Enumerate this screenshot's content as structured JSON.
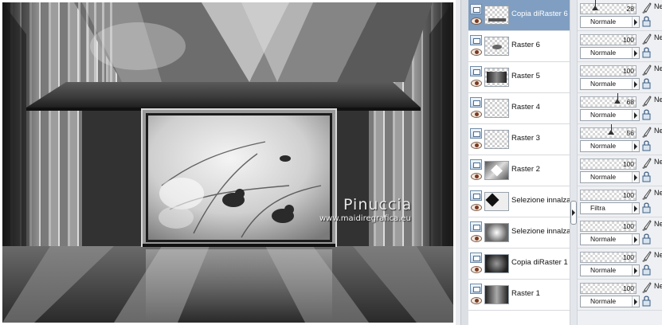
{
  "canvas": {
    "watermark_title": "Pinuccia",
    "watermark_url": "www.maidiregrafica.eu"
  },
  "layers": [
    {
      "name": "Copia diRaster 6",
      "selected": true,
      "thumb": "bar-icon"
    },
    {
      "name": "Raster 6",
      "selected": false,
      "thumb": "bird-icon"
    },
    {
      "name": "Raster 5",
      "selected": false,
      "thumb": "dark-frame-icon"
    },
    {
      "name": "Raster 4",
      "selected": false,
      "thumb": "transparent"
    },
    {
      "name": "Raster 3",
      "selected": false,
      "thumb": "transparent"
    },
    {
      "name": "Raster 2",
      "selected": false,
      "thumb": "pattern-icon"
    },
    {
      "name": "Selezione innalzat",
      "selected": false,
      "thumb": "chevron-pattern-icon"
    },
    {
      "name": "Selezione innalzat",
      "selected": false,
      "thumb": "star-pattern-icon"
    },
    {
      "name": "Copia diRaster 1",
      "selected": false,
      "thumb": "dark-pattern-icon"
    },
    {
      "name": "Raster 1",
      "selected": false,
      "thumb": "gradient-icon"
    }
  ],
  "properties": [
    {
      "opacity": 28,
      "opacity_text": "28",
      "blend": "Normale",
      "truncated": "Ne"
    },
    {
      "opacity": 100,
      "opacity_text": "100",
      "blend": "Normale",
      "truncated": "Ne"
    },
    {
      "opacity": 100,
      "opacity_text": "100",
      "blend": "Normale",
      "truncated": "Ne"
    },
    {
      "opacity": 68,
      "opacity_text": "68",
      "blend": "Normale",
      "truncated": "Ne"
    },
    {
      "opacity": 56,
      "opacity_text": "56",
      "blend": "Normale",
      "truncated": "Ne"
    },
    {
      "opacity": 100,
      "opacity_text": "100",
      "blend": "Normale",
      "truncated": "Ne"
    },
    {
      "opacity": 100,
      "opacity_text": "100",
      "blend": "Filtra",
      "truncated": "Ne"
    },
    {
      "opacity": 100,
      "opacity_text": "100",
      "blend": "Normale",
      "truncated": "Ne"
    },
    {
      "opacity": 100,
      "opacity_text": "100",
      "blend": "Normale",
      "truncated": "Ne"
    },
    {
      "opacity": 100,
      "opacity_text": "100",
      "blend": "Normale",
      "truncated": "Ne"
    }
  ],
  "colors": {
    "selected_row": "#7f9ec1",
    "panel_bg": "#eef0f3"
  }
}
